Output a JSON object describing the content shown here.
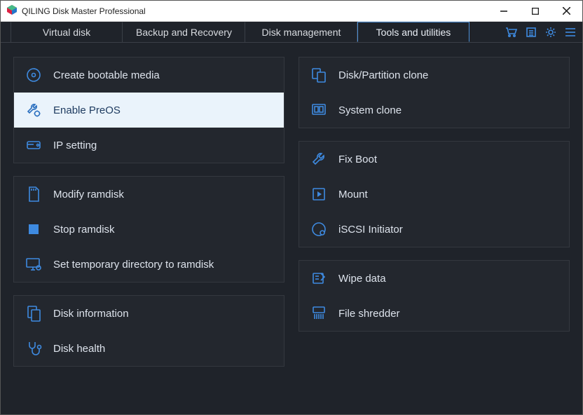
{
  "titlebar": {
    "title": "QILING Disk Master Professional"
  },
  "tabs": {
    "t0": "Virtual disk",
    "t1": "Backup and Recovery",
    "t2": "Disk management",
    "t3": "Tools and utilities"
  },
  "left": {
    "g0": {
      "i0": "Create bootable media",
      "i1": "Enable PreOS",
      "i2": "IP setting"
    },
    "g1": {
      "i0": "Modify ramdisk",
      "i1": "Stop ramdisk",
      "i2": "Set temporary directory to ramdisk"
    },
    "g2": {
      "i0": "Disk information",
      "i1": "Disk health"
    }
  },
  "right": {
    "g0": {
      "i0": "Disk/Partition clone",
      "i1": "System clone"
    },
    "g1": {
      "i0": "Fix Boot",
      "i1": "Mount",
      "i2": "iSCSI Initiator"
    },
    "g2": {
      "i0": "Wipe data",
      "i1": "File shredder"
    }
  }
}
